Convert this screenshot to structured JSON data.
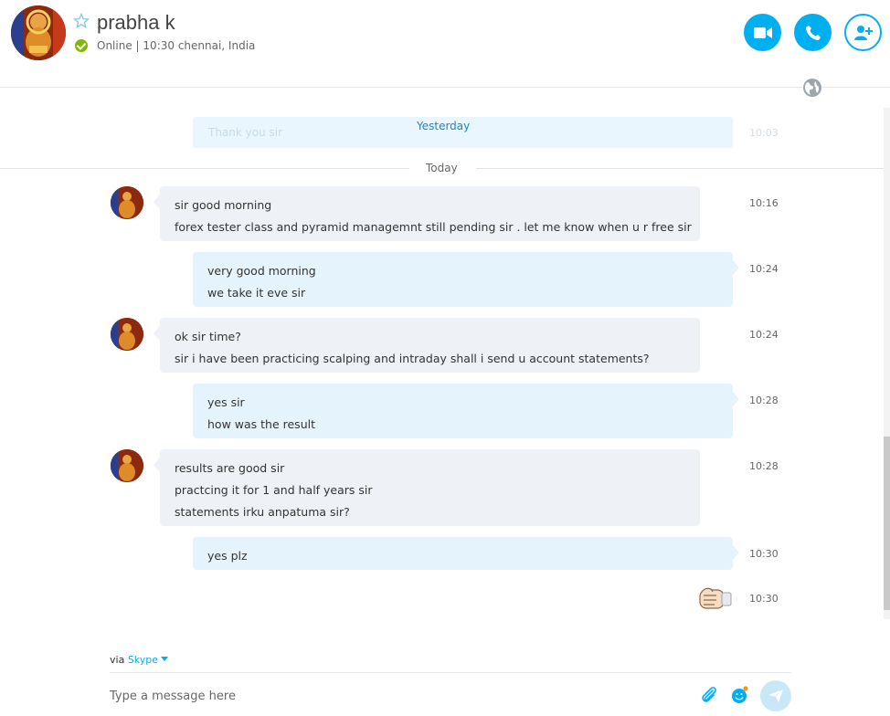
{
  "header": {
    "contact_name": "prabha k",
    "status": "Online",
    "separator": "|",
    "local_time": "10:30 chennai, India",
    "buttons": [
      "video-call",
      "voice-call",
      "add-people"
    ]
  },
  "previous": {
    "text": "Thank you sir",
    "time": "10:03",
    "day_label": "Yesterday"
  },
  "today_label": "Today",
  "messages": [
    {
      "dir": "in",
      "lines": [
        "sir good morning",
        "forex tester class and pyramid managemnt still pending sir . let me know when u r free sir"
      ],
      "time": "10:16"
    },
    {
      "dir": "out",
      "lines": [
        "very good morning",
        "we take it eve sir"
      ],
      "time": "10:24"
    },
    {
      "dir": "in",
      "lines": [
        "ok sir time?",
        "sir i have been practicing scalping and intraday shall i send u account statements?"
      ],
      "time": "10:24"
    },
    {
      "dir": "out",
      "lines": [
        "yes sir",
        "how was the result"
      ],
      "time": "10:28"
    },
    {
      "dir": "in",
      "lines": [
        "results are good sir",
        "practcing it for 1 and half years sir",
        "statements irku anpatuma sir?"
      ],
      "time": "10:28"
    },
    {
      "dir": "out",
      "lines": [
        "yes plz"
      ],
      "time": "10:30"
    }
  ],
  "emoticon": {
    "name": "fist-bump-emoticon",
    "time": "10:30"
  },
  "compose": {
    "via_prefix": "via",
    "via_service": "Skype",
    "placeholder": "Type a message here"
  },
  "colors": {
    "accent": "#00aff0",
    "status_online": "#7fba00",
    "incoming_bg": "#eef1f5",
    "outgoing_bg": "#e5f4fc"
  }
}
